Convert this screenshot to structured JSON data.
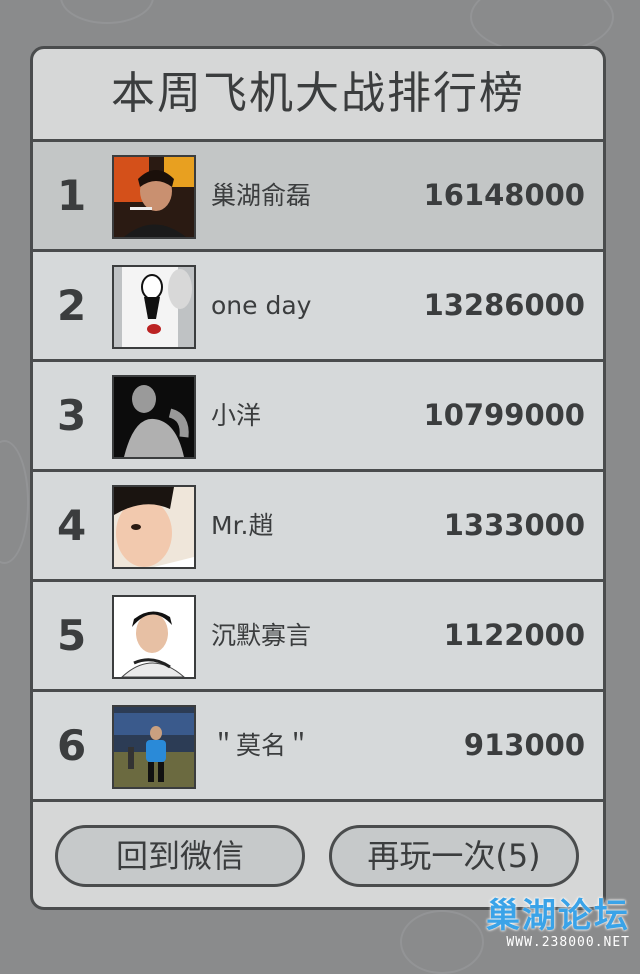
{
  "title": "本周飞机大战排行榜",
  "ranking": [
    {
      "rank": "1",
      "name": "巢湖俞磊",
      "score": "16148000",
      "avatar": "avatar-smoking-man"
    },
    {
      "rank": "2",
      "name": "one day",
      "score": "13286000",
      "avatar": "avatar-toilet-paper-face"
    },
    {
      "rank": "3",
      "name": "小洋",
      "score": "10799000",
      "avatar": "avatar-bw-shirtless-man"
    },
    {
      "rank": "4",
      "name": "Mr.趙",
      "score": "1333000",
      "avatar": "avatar-young-man-closeup"
    },
    {
      "rank": "5",
      "name": "沉默寡言",
      "score": "1122000",
      "avatar": "avatar-young-man-white-shirt"
    },
    {
      "rank": "6",
      "name": "＂莫名＂",
      "score": "913000",
      "avatar": "avatar-man-blue-jacket"
    }
  ],
  "buttons": {
    "back_label": "回到微信",
    "replay_label": "再玩一次(5)"
  },
  "watermark": {
    "logo": "巢湖论坛",
    "url": "WWW.238000.NET"
  },
  "colors": {
    "background": "#8a8b8c",
    "panel": "#d6d7d7",
    "highlight_row": "#c3c6c6",
    "text": "#3b3d3e",
    "watermark": "#3aa3e8"
  }
}
